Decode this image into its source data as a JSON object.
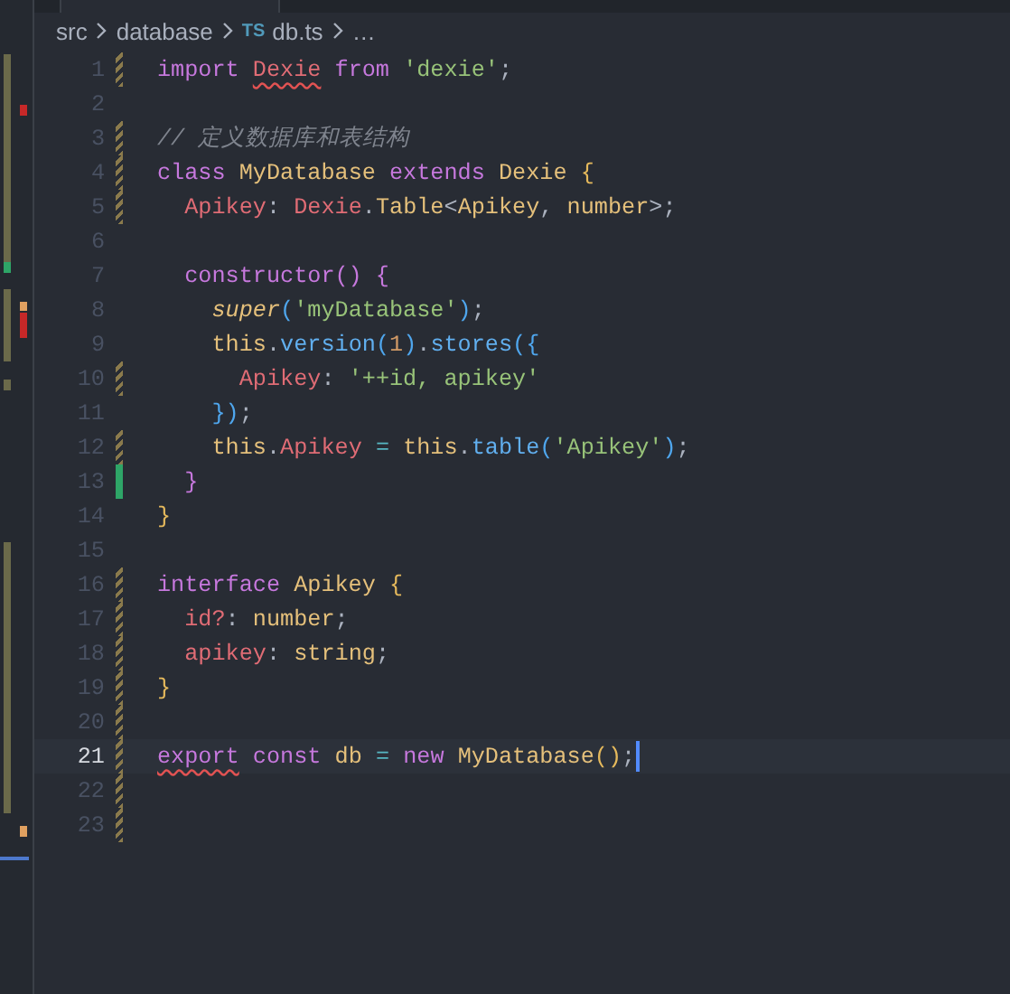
{
  "breadcrumb": [
    {
      "label": "src",
      "kind": "folder"
    },
    {
      "label": "database",
      "kind": "folder"
    },
    {
      "label": "db.ts",
      "kind": "file",
      "badge": "TS"
    },
    {
      "label": "…",
      "kind": "more"
    }
  ],
  "lines": [
    {
      "number": "1",
      "modified": true,
      "added": false,
      "current": false,
      "tokens": [
        {
          "text": "import ",
          "kind": "keyword",
          "error": false
        },
        {
          "text": "Dexie",
          "kind": "variable",
          "error": true
        },
        {
          "text": " from ",
          "kind": "keyword",
          "error": false
        },
        {
          "text": "'dexie'",
          "kind": "string",
          "error": false
        },
        {
          "text": ";",
          "kind": "punct",
          "error": false
        }
      ]
    },
    {
      "number": "2",
      "modified": false,
      "added": false,
      "current": false
    },
    {
      "number": "3",
      "modified": true,
      "added": false,
      "current": false,
      "tokens": [
        {
          "text": "// 定义数据库和表结构",
          "kind": "comment",
          "error": false
        }
      ]
    },
    {
      "number": "4",
      "modified": true,
      "added": false,
      "current": false,
      "tokens": [
        {
          "text": "class ",
          "kind": "keyword",
          "error": false
        },
        {
          "text": "MyDatabase ",
          "kind": "type",
          "error": false
        },
        {
          "text": "extends ",
          "kind": "keyword",
          "error": false
        },
        {
          "text": "Dexie ",
          "kind": "type",
          "error": false
        },
        {
          "text": "{",
          "kind": "bracket1",
          "error": false
        }
      ]
    },
    {
      "number": "5",
      "modified": true,
      "added": false,
      "current": false,
      "tokens": [
        {
          "text": "  Apikey",
          "kind": "variable",
          "error": false
        },
        {
          "text": ": ",
          "kind": "punct",
          "error": false
        },
        {
          "text": "Dexie",
          "kind": "variable",
          "error": false
        },
        {
          "text": ".",
          "kind": "punct",
          "error": false
        },
        {
          "text": "Table",
          "kind": "type",
          "error": false
        },
        {
          "text": "<",
          "kind": "punct",
          "error": false
        },
        {
          "text": "Apikey",
          "kind": "type",
          "error": false
        },
        {
          "text": ", ",
          "kind": "punct",
          "error": false
        },
        {
          "text": "number",
          "kind": "type",
          "error": false
        },
        {
          "text": ">;",
          "kind": "punct",
          "error": false
        }
      ]
    },
    {
      "number": "6",
      "modified": false,
      "added": false,
      "current": false
    },
    {
      "number": "7",
      "modified": false,
      "added": false,
      "current": false,
      "tokens": [
        {
          "text": "  constructor",
          "kind": "keyword",
          "error": false
        },
        {
          "text": "() {",
          "kind": "bracket2",
          "error": false
        }
      ]
    },
    {
      "number": "8",
      "modified": false,
      "added": false,
      "current": false,
      "tokens": [
        {
          "text": "    super",
          "kind": "special",
          "error": false
        },
        {
          "text": "(",
          "kind": "bracket3",
          "error": false
        },
        {
          "text": "'myDatabase'",
          "kind": "string",
          "error": false
        },
        {
          "text": ")",
          "kind": "bracket3",
          "error": false
        },
        {
          "text": ";",
          "kind": "punct",
          "error": false
        }
      ]
    },
    {
      "number": "9",
      "modified": false,
      "added": false,
      "current": false,
      "tokens": [
        {
          "text": "    this",
          "kind": "type",
          "error": false
        },
        {
          "text": ".",
          "kind": "punct",
          "error": false
        },
        {
          "text": "version",
          "kind": "function",
          "error": false
        },
        {
          "text": "(",
          "kind": "bracket3",
          "error": false
        },
        {
          "text": "1",
          "kind": "number",
          "error": false
        },
        {
          "text": ")",
          "kind": "bracket3",
          "error": false
        },
        {
          "text": ".",
          "kind": "punct",
          "error": false
        },
        {
          "text": "stores",
          "kind": "function",
          "error": false
        },
        {
          "text": "({",
          "kind": "bracket3",
          "error": false
        }
      ]
    },
    {
      "number": "10",
      "modified": true,
      "added": false,
      "current": false,
      "tokens": [
        {
          "text": "      Apikey",
          "kind": "variable",
          "error": false
        },
        {
          "text": ": ",
          "kind": "punct",
          "error": false
        },
        {
          "text": "'++id, apikey'",
          "kind": "string",
          "error": false
        }
      ]
    },
    {
      "number": "11",
      "modified": false,
      "added": false,
      "current": false,
      "tokens": [
        {
          "text": "    })",
          "kind": "bracket3",
          "error": false
        },
        {
          "text": ";",
          "kind": "punct",
          "error": false
        }
      ]
    },
    {
      "number": "12",
      "modified": true,
      "added": false,
      "current": false,
      "tokens": [
        {
          "text": "    this",
          "kind": "type",
          "error": false
        },
        {
          "text": ".",
          "kind": "punct",
          "error": false
        },
        {
          "text": "Apikey ",
          "kind": "variable",
          "error": false
        },
        {
          "text": "= ",
          "kind": "operator",
          "error": false
        },
        {
          "text": "this",
          "kind": "type",
          "error": false
        },
        {
          "text": ".",
          "kind": "punct",
          "error": false
        },
        {
          "text": "table",
          "kind": "function",
          "error": false
        },
        {
          "text": "(",
          "kind": "bracket3",
          "error": false
        },
        {
          "text": "'Apikey'",
          "kind": "string",
          "error": false
        },
        {
          "text": ")",
          "kind": "bracket3",
          "error": false
        },
        {
          "text": ";",
          "kind": "punct",
          "error": false
        }
      ]
    },
    {
      "number": "13",
      "modified": false,
      "added": true,
      "current": false,
      "tokens": [
        {
          "text": "  }",
          "kind": "bracket2",
          "error": false
        }
      ]
    },
    {
      "number": "14",
      "modified": false,
      "added": false,
      "current": false,
      "tokens": [
        {
          "text": "}",
          "kind": "bracket1",
          "error": false
        }
      ]
    },
    {
      "number": "15",
      "modified": false,
      "added": false,
      "current": false
    },
    {
      "number": "16",
      "modified": true,
      "added": false,
      "current": false,
      "tokens": [
        {
          "text": "interface ",
          "kind": "keyword",
          "error": false
        },
        {
          "text": "Apikey ",
          "kind": "type",
          "error": false
        },
        {
          "text": "{",
          "kind": "bracket1",
          "error": false
        }
      ]
    },
    {
      "number": "17",
      "modified": true,
      "added": false,
      "current": false,
      "tokens": [
        {
          "text": "  id?",
          "kind": "variable",
          "error": false
        },
        {
          "text": ": ",
          "kind": "punct",
          "error": false
        },
        {
          "text": "number",
          "kind": "type",
          "error": false
        },
        {
          "text": ";",
          "kind": "punct",
          "error": false
        }
      ]
    },
    {
      "number": "18",
      "modified": true,
      "added": false,
      "current": false,
      "tokens": [
        {
          "text": "  apikey",
          "kind": "variable",
          "error": false
        },
        {
          "text": ": ",
          "kind": "punct",
          "error": false
        },
        {
          "text": "string",
          "kind": "type",
          "error": false
        },
        {
          "text": ";",
          "kind": "punct",
          "error": false
        }
      ]
    },
    {
      "number": "19",
      "modified": true,
      "added": false,
      "current": false,
      "tokens": [
        {
          "text": "}",
          "kind": "bracket1",
          "error": false
        }
      ]
    },
    {
      "number": "20",
      "modified": true,
      "added": false,
      "current": false
    },
    {
      "number": "21",
      "modified": true,
      "added": false,
      "current": true,
      "tokens": [
        {
          "text": "export",
          "kind": "keyword",
          "error": true
        },
        {
          "text": " const ",
          "kind": "keyword",
          "error": false
        },
        {
          "text": "db ",
          "kind": "plain",
          "error": false
        },
        {
          "text": "= ",
          "kind": "operator",
          "error": false
        },
        {
          "text": "new ",
          "kind": "keyword",
          "error": false
        },
        {
          "text": "MyDatabase",
          "kind": "type",
          "error": false
        },
        {
          "text": "()",
          "kind": "bracket1",
          "error": false
        },
        {
          "text": ";",
          "kind": "punct",
          "error": false
        }
      ]
    },
    {
      "number": "22",
      "modified": true,
      "added": false,
      "current": false
    },
    {
      "number": "23",
      "modified": true,
      "added": false,
      "current": false
    }
  ]
}
